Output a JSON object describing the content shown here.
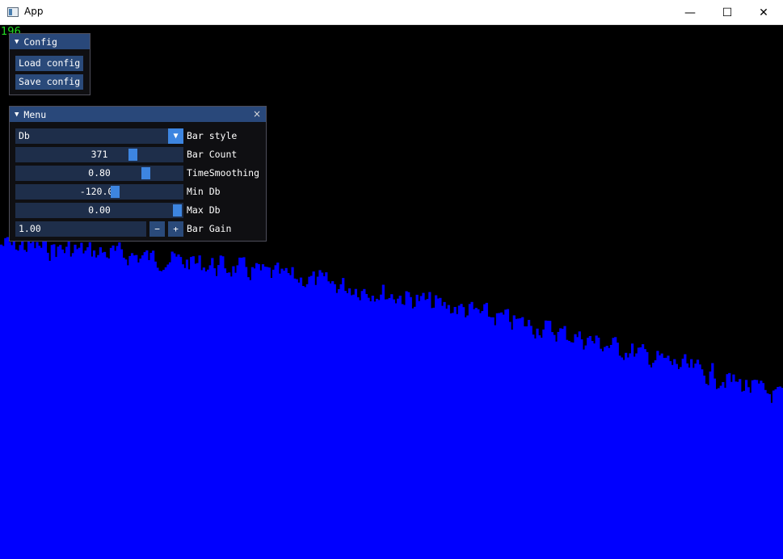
{
  "window": {
    "title": "App",
    "minimize_glyph": "—",
    "maximize_glyph": "☐",
    "close_glyph": "✕"
  },
  "fps": "196",
  "config_panel": {
    "title": "Config",
    "load_label": "Load config",
    "save_label": "Save config"
  },
  "menu_panel": {
    "title": "Menu",
    "close_glyph": "×",
    "bar_style": {
      "value": "Db",
      "label": "Bar style"
    },
    "bar_count": {
      "value": "371",
      "label": "Bar Count",
      "level": 0.714
    },
    "time_smoothing": {
      "value": "0.80",
      "label": "TimeSmoothing",
      "level": 0.8
    },
    "min_db": {
      "value": "-120.00",
      "label": "Min Db",
      "level": 0.6
    },
    "max_db": {
      "value": "0.00",
      "label": "Max Db",
      "level": 1.0
    },
    "bar_gain": {
      "value": "1.00",
      "label": "Bar Gain",
      "minus": "−",
      "plus": "+"
    }
  },
  "spectrum": {
    "bar_color": "#0000ff",
    "background": "#000000",
    "bar_count": 371
  }
}
